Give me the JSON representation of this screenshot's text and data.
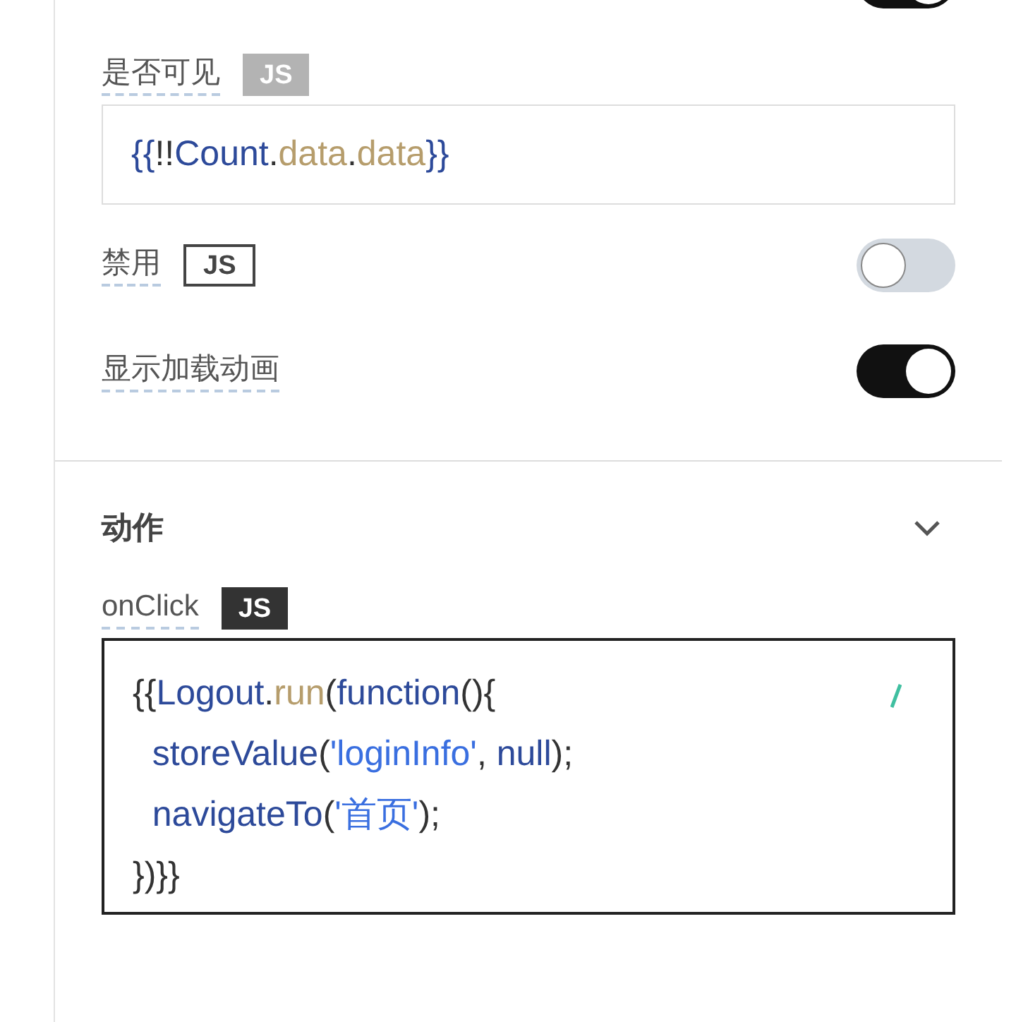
{
  "top_toggle": {
    "on": true
  },
  "fields": [
    {
      "kind": "expression",
      "label": "是否可见",
      "badge": {
        "text": "JS",
        "kind": "muted"
      },
      "tokens": [
        {
          "t": "{{",
          "kind": "brace"
        },
        {
          "t": "!!",
          "kind": "punct"
        },
        {
          "t": "Count",
          "kind": "ident"
        },
        {
          "t": ".",
          "kind": "punct"
        },
        {
          "t": "data",
          "kind": "member"
        },
        {
          "t": ".",
          "kind": "punct"
        },
        {
          "t": "data",
          "kind": "member"
        },
        {
          "t": "}}",
          "kind": "brace"
        }
      ]
    },
    {
      "kind": "switch",
      "label": "禁用",
      "badge": {
        "text": "JS",
        "kind": "outline"
      },
      "on": false
    },
    {
      "kind": "switch",
      "label": "显示加载动画",
      "on": true
    }
  ],
  "actions": {
    "title": "动作",
    "expanded": true,
    "event": {
      "label": "onClick",
      "badge": {
        "text": "JS",
        "kind": "dark"
      },
      "lines": [
        {
          "tokens": [
            {
              "t": "{{",
              "kind": "punct"
            },
            {
              "t": "Logout",
              "kind": "ident"
            },
            {
              "t": ".",
              "kind": "punct"
            },
            {
              "t": "run",
              "kind": "member"
            },
            {
              "t": "(",
              "kind": "punct"
            },
            {
              "t": "function",
              "kind": "ident"
            },
            {
              "t": "(){",
              "kind": "punct"
            }
          ]
        },
        {
          "tokens": [
            {
              "t": "  storeValue",
              "kind": "ident"
            },
            {
              "t": "(",
              "kind": "punct"
            },
            {
              "t": "'loginInfo'",
              "kind": "string"
            },
            {
              "t": ", ",
              "kind": "punct"
            },
            {
              "t": "null",
              "kind": "ident"
            },
            {
              "t": ");",
              "kind": "punct"
            }
          ]
        },
        {
          "tokens": [
            {
              "t": "  navigateTo",
              "kind": "ident"
            },
            {
              "t": "(",
              "kind": "punct"
            },
            {
              "t": "'首页'",
              "kind": "string"
            },
            {
              "t": ");",
              "kind": "punct"
            }
          ]
        },
        {
          "tokens": [
            {
              "t": "})}}",
              "kind": "punct"
            }
          ]
        }
      ]
    }
  }
}
